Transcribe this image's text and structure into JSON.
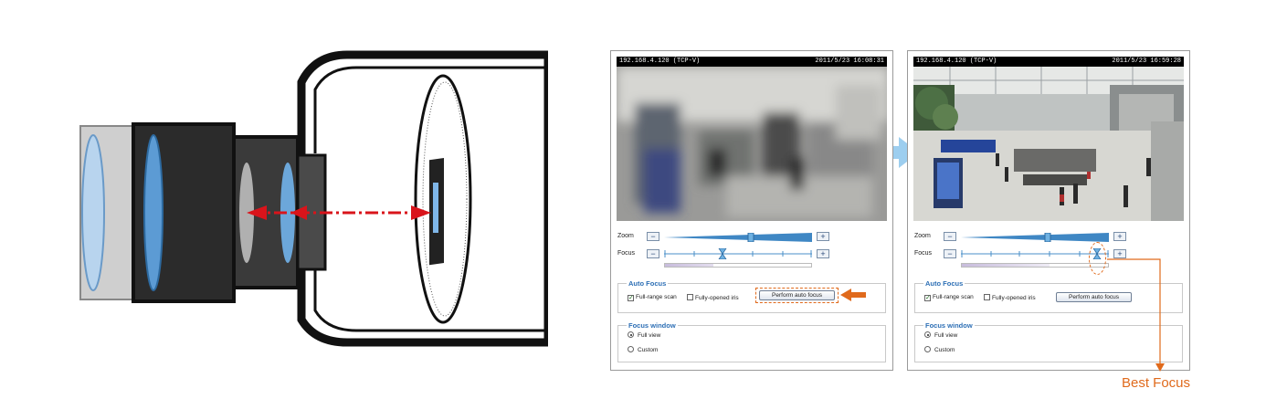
{
  "colors": {
    "accent": "#e06a1c",
    "link_blue": "#2d6fb5",
    "laser": "#d9141b"
  },
  "left_panel": {
    "ip": "192.168.4.120 (TCP-V)",
    "timestamp": "2011/5/23 16:08:31",
    "zoom_label": "Zoom",
    "focus_label": "Focus",
    "minus": "−",
    "plus": "+",
    "focus_progress": 0.33,
    "auto_focus": {
      "legend": "Auto Focus",
      "full_range": "Full-range scan",
      "full_range_checked": true,
      "fully_opened": "Fully-opened iris",
      "fully_opened_checked": false,
      "button": "Perform auto focus"
    },
    "focus_window": {
      "legend": "Focus window",
      "full_view": "Full view",
      "custom": "Custom",
      "selected": "Full view"
    }
  },
  "right_panel": {
    "ip": "192.168.4.120 (TCP-V)",
    "timestamp": "2011/5/23 16:59:28",
    "zoom_label": "Zoom",
    "focus_label": "Focus",
    "minus": "−",
    "plus": "+",
    "focus_progress": 0.6,
    "auto_focus": {
      "legend": "Auto Focus",
      "full_range": "Full-range scan",
      "full_range_checked": true,
      "fully_opened": "Fully-opened iris",
      "fully_opened_checked": false,
      "button": "Perform auto focus"
    },
    "focus_window": {
      "legend": "Focus window",
      "full_view": "Full view",
      "custom": "Custom",
      "selected": "Full view"
    }
  },
  "annotation": {
    "best_focus": "Best Focus"
  }
}
